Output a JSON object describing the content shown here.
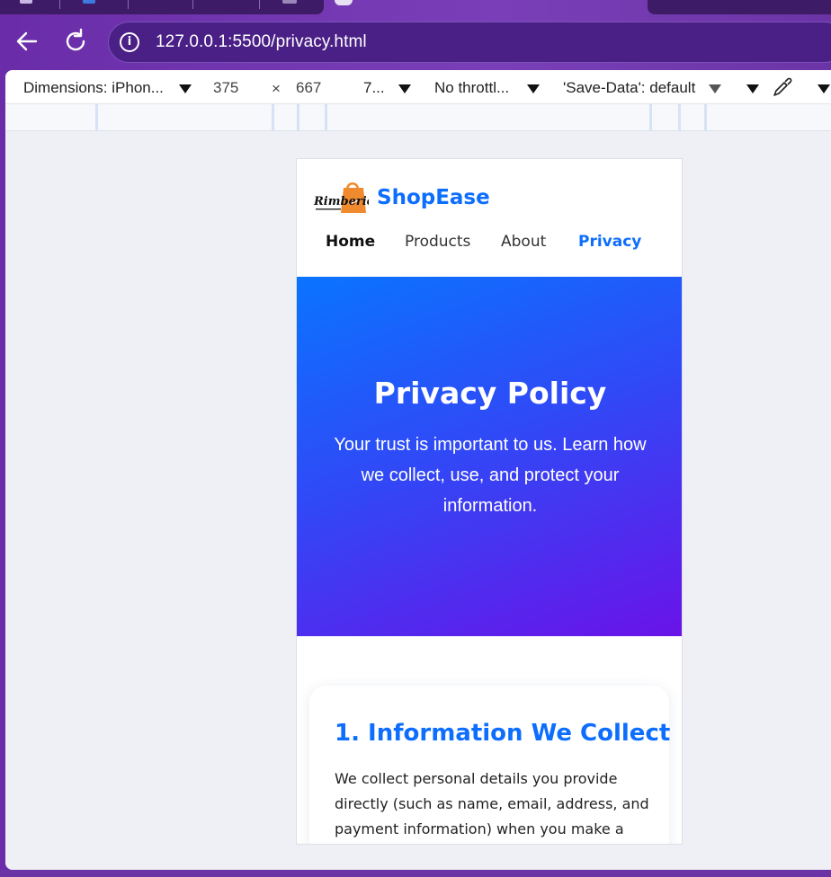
{
  "browser": {
    "url": "127.0.0.1:5500/privacy.html"
  },
  "devtools": {
    "dimensions_label": "Dimensions: iPhon...",
    "width": "375",
    "times": "×",
    "height": "667",
    "zoom": "7...",
    "throttling": "No throttl...",
    "save_data": "'Save-Data': default"
  },
  "site": {
    "logo_text": "Rimberio",
    "brand": "ShopEase",
    "nav": [
      "Home",
      "Products",
      "About",
      "Privacy"
    ],
    "hero_title": "Privacy Policy",
    "hero_subtitle": "Your trust is important to us. Learn how we collect, use, and protect your information.",
    "section_title": "1. Information We Collect",
    "section_text": "We collect personal details you provide directly (such as name, email, address, and payment information) when you make a"
  },
  "colors": {
    "brand_blue": "#0d6efd",
    "hero_start": "#0a74ff",
    "hero_end": "#6a13e8",
    "browser_frame": "#6a2ca8"
  }
}
